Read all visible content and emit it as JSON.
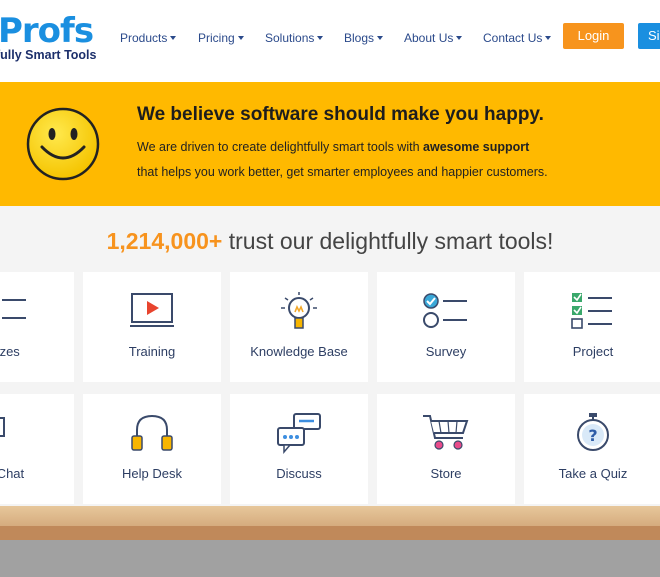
{
  "header": {
    "logo_word": "Profs",
    "logo_tagline": "fully Smart Tools",
    "nav": [
      {
        "label": "Products"
      },
      {
        "label": "Pricing"
      },
      {
        "label": "Solutions"
      },
      {
        "label": "Blogs"
      },
      {
        "label": "About Us"
      },
      {
        "label": "Contact Us"
      }
    ],
    "login_label": "Login",
    "signup_label": "Sig"
  },
  "banner": {
    "title": "We believe software should make you happy.",
    "line1_pre": "We are driven to create delightfully smart tools with ",
    "line1_bold": "awesome support",
    "line2": "that helps you work better, get smarter employees and happier customers.",
    "bg_color": "#ffb900"
  },
  "trust": {
    "count": "1,214,000+",
    "text": " trust our delightfully smart tools!",
    "accent_color": "#f7931e"
  },
  "products": [
    {
      "label": "izzes",
      "icon": "quiz-list-icon"
    },
    {
      "label": "Training",
      "icon": "video-play-icon"
    },
    {
      "label": "Knowledge Base",
      "icon": "lightbulb-icon"
    },
    {
      "label": "Survey",
      "icon": "survey-check-icon"
    },
    {
      "label": "Project",
      "icon": "checklist-icon"
    },
    {
      "label": "e Chat",
      "icon": "chat-window-icon"
    },
    {
      "label": "Help Desk",
      "icon": "headphones-icon"
    },
    {
      "label": "Discuss",
      "icon": "discussion-bubbles-icon"
    },
    {
      "label": "Store",
      "icon": "shopping-cart-icon"
    },
    {
      "label": "Take a Quiz",
      "icon": "stopwatch-question-icon"
    }
  ]
}
